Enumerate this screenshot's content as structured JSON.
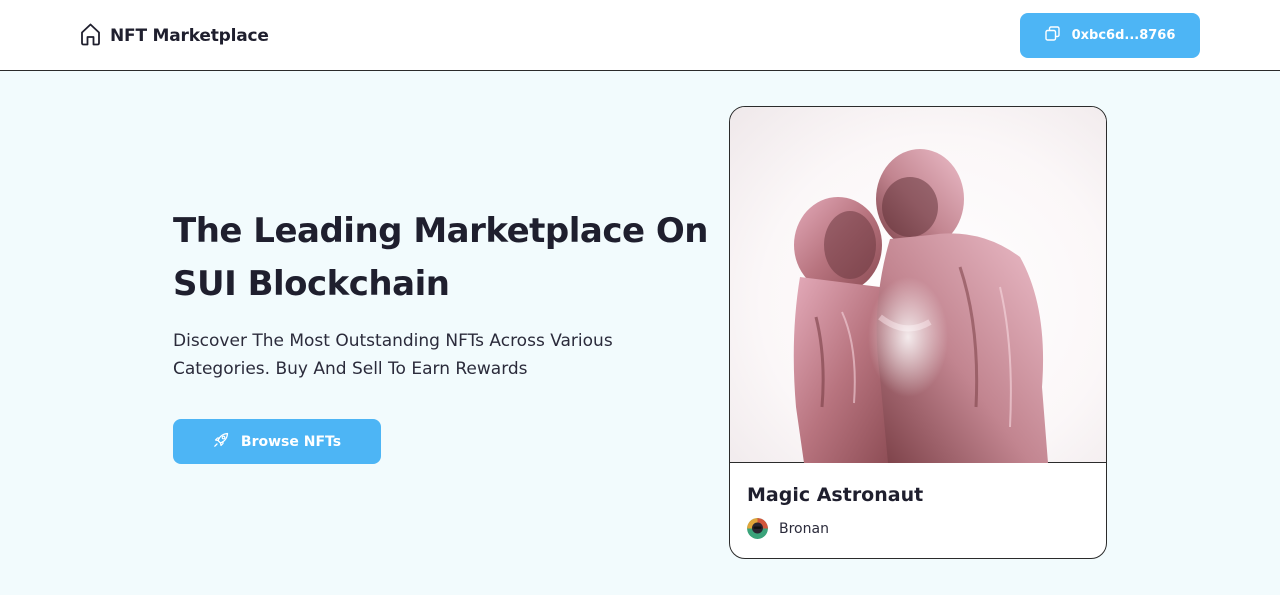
{
  "header": {
    "brand_title": "NFT Marketplace",
    "brand_icon": "home-icon",
    "wallet_address": "0xbc6d...8766",
    "wallet_icon": "copy-icon"
  },
  "hero": {
    "headline_line1": "The Leading Marketplace On",
    "headline_line2": "SUI Blockchain",
    "subtitle_line1": "Discover The Most Outstanding NFTs Across Various",
    "subtitle_line2": "Categories. Buy And Sell To Earn Rewards",
    "browse_label": "Browse NFTs",
    "browse_icon": "rocket-icon"
  },
  "featured_nft": {
    "title": "Magic Astronaut",
    "creator": "Bronan"
  },
  "colors": {
    "accent": "#4db5f5",
    "hero_background": "#f2fbfd",
    "text_dark": "#1f1f2e"
  }
}
